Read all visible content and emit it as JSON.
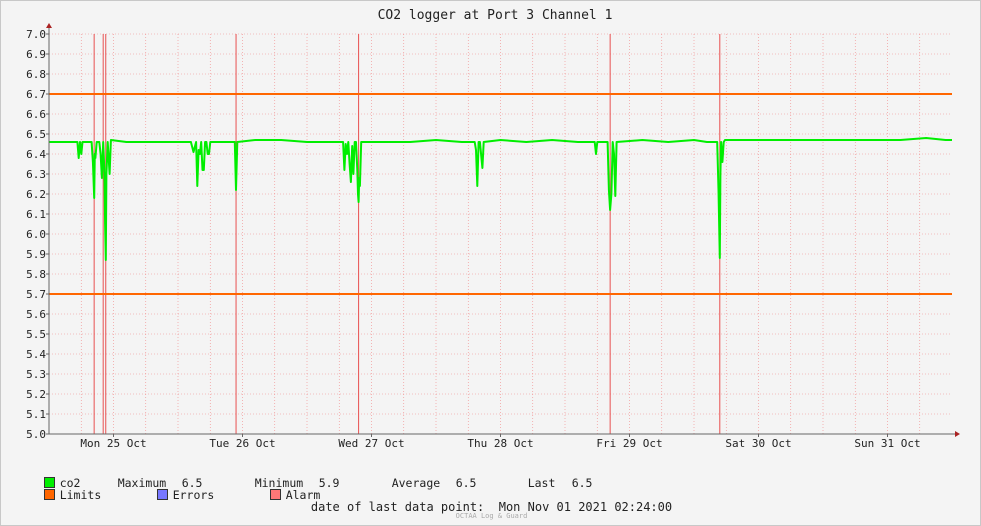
{
  "chart_data": {
    "type": "line",
    "title": "CO2 logger at Port 3 Channel 1",
    "ylim": [
      5.0,
      7.0
    ],
    "yticks": [
      "5.0",
      "5.1",
      "5.2",
      "5.3",
      "5.4",
      "5.5",
      "5.6",
      "5.7",
      "5.8",
      "5.9",
      "6.0",
      "6.1",
      "6.2",
      "6.3",
      "6.4",
      "6.5",
      "6.6",
      "6.7",
      "6.8",
      "6.9",
      "7.0"
    ],
    "xrange_days": [
      0,
      7
    ],
    "xtick_labels": [
      {
        "day": 0.5,
        "label": "Mon 25 Oct"
      },
      {
        "day": 1.5,
        "label": "Tue 26 Oct"
      },
      {
        "day": 2.5,
        "label": "Wed 27 Oct"
      },
      {
        "day": 3.5,
        "label": "Thu 28 Oct"
      },
      {
        "day": 4.5,
        "label": "Fri 29 Oct"
      },
      {
        "day": 5.5,
        "label": "Sat 30 Oct"
      },
      {
        "day": 6.5,
        "label": "Sun 31 Oct"
      }
    ],
    "grid": true,
    "limits": {
      "upper": 6.7,
      "lower": 5.7,
      "color": "#ff6600"
    },
    "alarm_events_days": [
      0.35,
      0.42,
      0.44,
      1.45,
      2.4,
      4.35,
      5.2
    ],
    "series": [
      {
        "name": "co2",
        "color": "#00ee00",
        "points": [
          [
            0.0,
            6.46
          ],
          [
            0.1,
            6.46
          ],
          [
            0.22,
            6.46
          ],
          [
            0.23,
            6.38
          ],
          [
            0.24,
            6.46
          ],
          [
            0.25,
            6.4
          ],
          [
            0.26,
            6.46
          ],
          [
            0.33,
            6.46
          ],
          [
            0.34,
            6.36
          ],
          [
            0.35,
            6.18
          ],
          [
            0.355,
            6.4
          ],
          [
            0.36,
            6.38
          ],
          [
            0.37,
            6.46
          ],
          [
            0.38,
            6.46
          ],
          [
            0.39,
            6.46
          ],
          [
            0.4,
            6.4
          ],
          [
            0.41,
            6.28
          ],
          [
            0.42,
            6.46
          ],
          [
            0.43,
            6.3
          ],
          [
            0.435,
            6.05
          ],
          [
            0.44,
            5.87
          ],
          [
            0.445,
            6.3
          ],
          [
            0.455,
            6.46
          ],
          [
            0.47,
            6.3
          ],
          [
            0.48,
            6.47
          ],
          [
            0.6,
            6.46
          ],
          [
            0.8,
            6.46
          ],
          [
            1.0,
            6.46
          ],
          [
            1.1,
            6.46
          ],
          [
            1.12,
            6.41
          ],
          [
            1.14,
            6.46
          ],
          [
            1.15,
            6.24
          ],
          [
            1.16,
            6.42
          ],
          [
            1.17,
            6.4
          ],
          [
            1.18,
            6.46
          ],
          [
            1.19,
            6.32
          ],
          [
            1.2,
            6.32
          ],
          [
            1.21,
            6.46
          ],
          [
            1.22,
            6.46
          ],
          [
            1.23,
            6.4
          ],
          [
            1.24,
            6.4
          ],
          [
            1.25,
            6.46
          ],
          [
            1.38,
            6.46
          ],
          [
            1.4,
            6.46
          ],
          [
            1.44,
            6.46
          ],
          [
            1.45,
            6.22
          ],
          [
            1.46,
            6.46
          ],
          [
            1.6,
            6.47
          ],
          [
            1.8,
            6.47
          ],
          [
            2.0,
            6.46
          ],
          [
            2.2,
            6.46
          ],
          [
            2.28,
            6.46
          ],
          [
            2.29,
            6.32
          ],
          [
            2.3,
            6.45
          ],
          [
            2.31,
            6.4
          ],
          [
            2.32,
            6.46
          ],
          [
            2.33,
            6.35
          ],
          [
            2.34,
            6.26
          ],
          [
            2.35,
            6.44
          ],
          [
            2.36,
            6.3
          ],
          [
            2.37,
            6.46
          ],
          [
            2.38,
            6.46
          ],
          [
            2.39,
            6.32
          ],
          [
            2.395,
            6.2
          ],
          [
            2.4,
            6.16
          ],
          [
            2.405,
            6.28
          ],
          [
            2.41,
            6.24
          ],
          [
            2.42,
            6.46
          ],
          [
            2.6,
            6.46
          ],
          [
            2.8,
            6.46
          ],
          [
            3.0,
            6.47
          ],
          [
            3.2,
            6.46
          ],
          [
            3.3,
            6.46
          ],
          [
            3.31,
            6.42
          ],
          [
            3.32,
            6.24
          ],
          [
            3.33,
            6.46
          ],
          [
            3.34,
            6.46
          ],
          [
            3.36,
            6.33
          ],
          [
            3.37,
            6.46
          ],
          [
            3.5,
            6.47
          ],
          [
            3.7,
            6.46
          ],
          [
            3.9,
            6.47
          ],
          [
            4.1,
            6.46
          ],
          [
            4.2,
            6.46
          ],
          [
            4.23,
            6.46
          ],
          [
            4.24,
            6.4
          ],
          [
            4.25,
            6.46
          ],
          [
            4.3,
            6.46
          ],
          [
            4.33,
            6.46
          ],
          [
            4.34,
            6.22
          ],
          [
            4.35,
            6.12
          ],
          [
            4.36,
            6.2
          ],
          [
            4.37,
            6.46
          ],
          [
            4.38,
            6.4
          ],
          [
            4.39,
            6.19
          ],
          [
            4.4,
            6.46
          ],
          [
            4.6,
            6.47
          ],
          [
            4.8,
            6.46
          ],
          [
            5.0,
            6.47
          ],
          [
            5.1,
            6.46
          ],
          [
            5.18,
            6.46
          ],
          [
            5.19,
            6.22
          ],
          [
            5.2,
            5.88
          ],
          [
            5.205,
            6.3
          ],
          [
            5.21,
            6.46
          ],
          [
            5.22,
            6.36
          ],
          [
            5.23,
            6.46
          ],
          [
            5.24,
            6.47
          ],
          [
            5.4,
            6.47
          ],
          [
            5.6,
            6.47
          ],
          [
            5.8,
            6.47
          ],
          [
            6.0,
            6.47
          ],
          [
            6.2,
            6.47
          ],
          [
            6.4,
            6.47
          ],
          [
            6.6,
            6.47
          ],
          [
            6.8,
            6.48
          ],
          [
            6.95,
            6.47
          ],
          [
            7.0,
            6.47
          ]
        ]
      }
    ]
  },
  "legend": {
    "series_name": "co2",
    "max_label": "Maximum",
    "max_value": "6.5",
    "min_label": "Minimum",
    "min_value": "5.9",
    "avg_label": "Average",
    "avg_value": "6.5",
    "last_label": "Last",
    "last_value": "6.5",
    "limits_label": "Limits",
    "errors_label": "Errors",
    "alarm_label": "Alarm",
    "colors": {
      "co2": "#00ee00",
      "limits": "#ff6600",
      "errors": "#7777ff",
      "alarm": "#ff7777"
    }
  },
  "footer": {
    "last_point_label": "date of last data point:",
    "last_point_value": "Mon Nov 01 2021 02:24:00",
    "watermark": "OCTAA Log & Guard"
  }
}
